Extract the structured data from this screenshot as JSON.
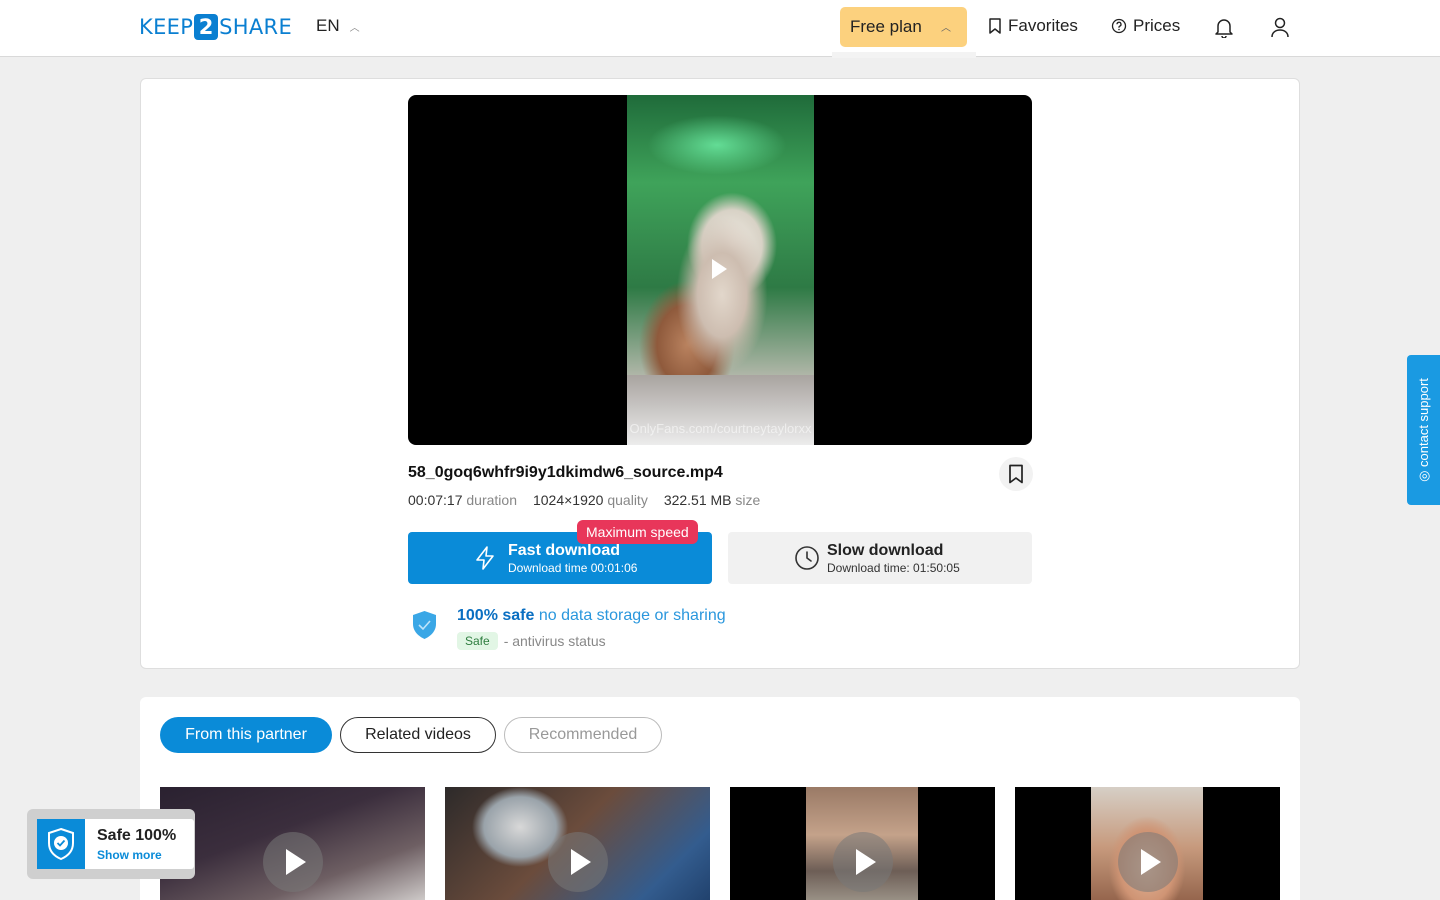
{
  "header": {
    "logo_left": "KEEP",
    "logo_mid": "2",
    "logo_right": "SHARE",
    "language": "EN",
    "plan_label": "Free plan",
    "favorites_label": "Favorites",
    "prices_label": "Prices"
  },
  "video": {
    "watermark": "OnlyFans.com/courtneytaylorxx",
    "filename": "58_0goq6whfr9i9y1dkimdw6_source.mp4",
    "duration_value": "00:07:17",
    "duration_label": "duration",
    "quality_value": "1024×1920",
    "quality_label": "quality",
    "size_value": "322.51 MB",
    "size_label": "size"
  },
  "download": {
    "badge": "Maximum speed",
    "fast_title": "Fast download",
    "fast_sub": "Download time 00:01:06",
    "slow_title": "Slow download",
    "slow_sub": "Download time: 01:50:05"
  },
  "safety": {
    "strong": "100% safe",
    "rest": "no data storage or sharing",
    "pill": "Safe",
    "antivirus": "- antivirus status"
  },
  "support": {
    "label": "◎ contact support"
  },
  "tabs": [
    {
      "label": "From this partner",
      "active": true
    },
    {
      "label": "Related videos",
      "active": false
    },
    {
      "label": "Recommended",
      "active": false
    }
  ],
  "safe_widget": {
    "title": "Safe 100%",
    "link": "Show more"
  },
  "colors": {
    "brand": "#0a8bd8",
    "plan": "#fcd17e",
    "badge": "#e8365a",
    "support": "#1a9ae2"
  },
  "icons": [
    "chevron-up-icon",
    "bookmark-icon",
    "help-circle-icon",
    "bell-icon",
    "user-icon",
    "lightning-icon",
    "clock-icon",
    "shield-check-icon",
    "play-icon"
  ]
}
